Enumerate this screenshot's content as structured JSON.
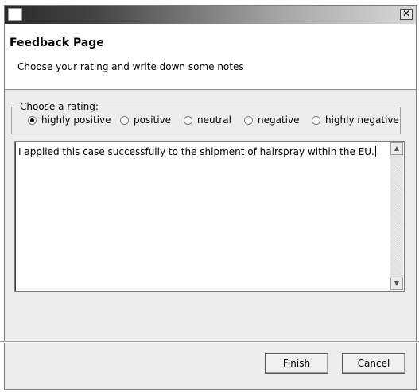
{
  "window": {
    "close_glyph": "✕"
  },
  "header": {
    "title": "Feedback Page",
    "description": "Choose your rating and write down some notes"
  },
  "rating": {
    "legend": "Choose a rating:",
    "options": [
      {
        "label": "highly positive",
        "selected": true
      },
      {
        "label": "positive",
        "selected": false
      },
      {
        "label": "neutral",
        "selected": false
      },
      {
        "label": "negative",
        "selected": false
      },
      {
        "label": "highly negative",
        "selected": false
      }
    ]
  },
  "notes": {
    "value": "I applied this case successfully to the shipment of hairspray within the EU."
  },
  "scrollbar": {
    "up_glyph": "▲",
    "down_glyph": "▼"
  },
  "buttons": {
    "finish": "Finish",
    "cancel": "Cancel"
  }
}
